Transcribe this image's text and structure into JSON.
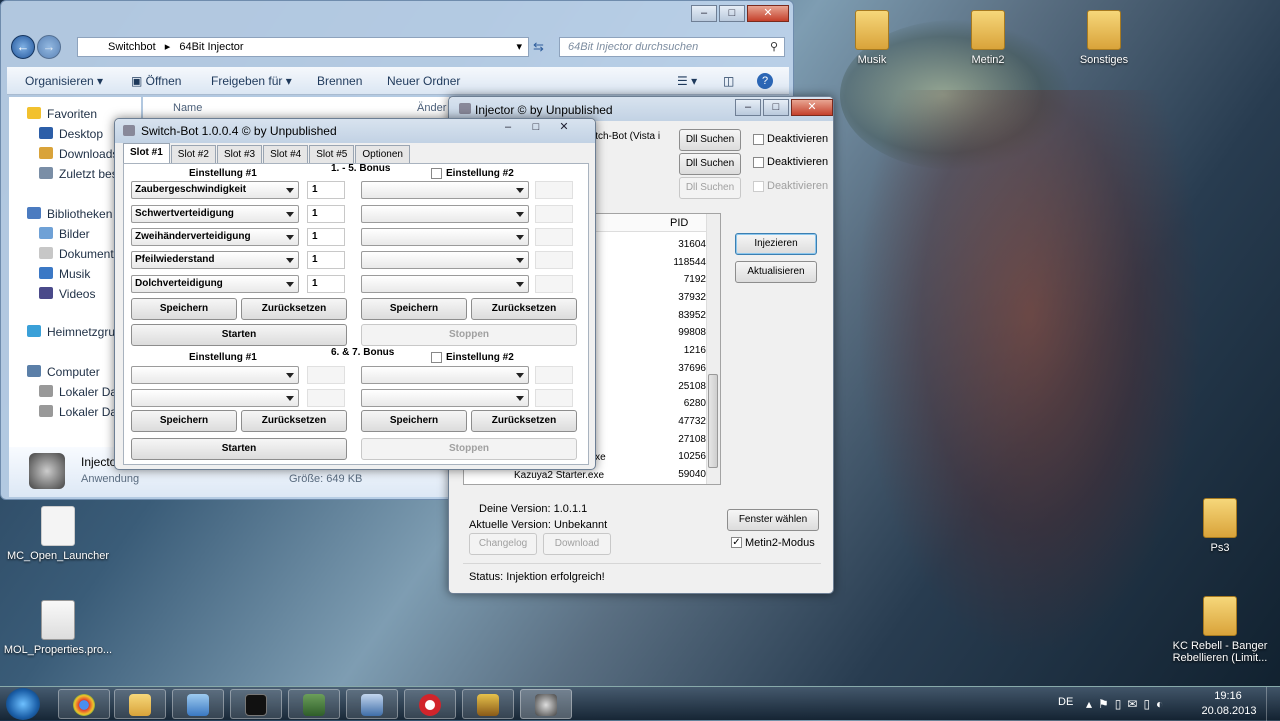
{
  "desktop": {
    "icons": [
      {
        "label": "Musik",
        "icon": "folder-icon"
      },
      {
        "label": "Metin2",
        "icon": "folder-icon"
      },
      {
        "label": "Sonstiges",
        "icon": "folder-icon"
      },
      {
        "label": "Ps3",
        "icon": "folder-icon"
      },
      {
        "label": "KC Rebell - Banger Rebellieren (Limit...",
        "icon": "folder-icon"
      },
      {
        "label": "MC_Open_Launcher",
        "icon": "file-icon"
      },
      {
        "label": "MOL_Properties.pro...",
        "icon": "document-icon"
      }
    ]
  },
  "explorer": {
    "breadcrumb": [
      "Switchbot",
      "64Bit Injector"
    ],
    "search_placeholder": "64Bit Injector durchsuchen",
    "toolbar": {
      "organize": "Organisieren",
      "open": "Öffnen",
      "share": "Freigeben für",
      "burn": "Brennen",
      "new_folder": "Neuer Ordner"
    },
    "columns": {
      "name": "Name",
      "modified": "Änder"
    },
    "nav": {
      "favorites": "Favoriten",
      "desktop": "Desktop",
      "downloads": "Downloads",
      "recent": "Zuletzt besu",
      "libraries": "Bibliotheken",
      "pictures": "Bilder",
      "documents": "Dokumente",
      "music": "Musik",
      "videos": "Videos",
      "homegroup": "Heimnetzgru",
      "computer": "Computer",
      "disk1": "Lokaler Date",
      "disk2": "Lokaler Date"
    },
    "details": {
      "name": "Injecto",
      "type": "Anwendung",
      "size": "Größe: 649 KB"
    }
  },
  "switchbot": {
    "title": "Switch-Bot 1.0.0.4 © by Unpublished",
    "tabs": [
      "Slot #1",
      "Slot #2",
      "Slot #3",
      "Slot #4",
      "Slot #5",
      "Optionen"
    ],
    "section1": {
      "title": "1. - 5. Bonus",
      "setting1": "Einstellung #1",
      "setting2": "Einstellung #2",
      "rows": [
        {
          "bonus": "Zaubergeschwindigkeit",
          "value": "1"
        },
        {
          "bonus": "Schwertverteidigung",
          "value": "1"
        },
        {
          "bonus": "Zweihänderverteidigung",
          "value": "1"
        },
        {
          "bonus": "Pfeilwiederstand",
          "value": "1"
        },
        {
          "bonus": "Dolchverteidigung",
          "value": "1"
        }
      ]
    },
    "section2": {
      "title": "6. & 7. Bonus",
      "setting1": "Einstellung #1",
      "setting2": "Einstellung #2"
    },
    "buttons": {
      "save": "Speichern",
      "reset": "Zurücksetzen",
      "start": "Starten",
      "stop": "Stoppen"
    }
  },
  "injector": {
    "title": "Injector © by Unpublished",
    "process_label": "itch-Bot (Vista i",
    "dll_search": "Dll Suchen",
    "deactivate": "Deaktivieren",
    "pid_header": "PID",
    "pids": [
      "31604",
      "118544",
      "7192",
      "37932",
      "83952",
      "99808",
      "1216",
      "37696",
      "25108",
      "6280",
      "47732",
      "27108",
      "10256",
      "59040"
    ],
    "visible_process_names": [
      "r.exe",
      "Kazuya2 Starter.exe"
    ],
    "inject_button": "Injezieren",
    "refresh_button": "Aktualisieren",
    "your_version": "Deine Version: 1.0.1.1",
    "current_version": "Aktuelle Version: Unbekannt",
    "changelog": "Changelog",
    "download": "Download",
    "choose_window": "Fenster wählen",
    "metin2_mode": "Metin2-Modus",
    "status": "Status: Injektion erfolgreich!"
  },
  "taskbar": {
    "apps": [
      "chrome-icon",
      "explorer-icon",
      "control-panel-icon",
      "cmd-icon",
      "monitor-icon",
      "network-icon",
      "opera-icon",
      "metin2-icon",
      "gear-icon"
    ],
    "language": "DE",
    "time": "19:16",
    "date": "20.08.2013"
  },
  "colors": {
    "accent": "#3f6ea8",
    "window_bg": "#f0f0f0"
  }
}
